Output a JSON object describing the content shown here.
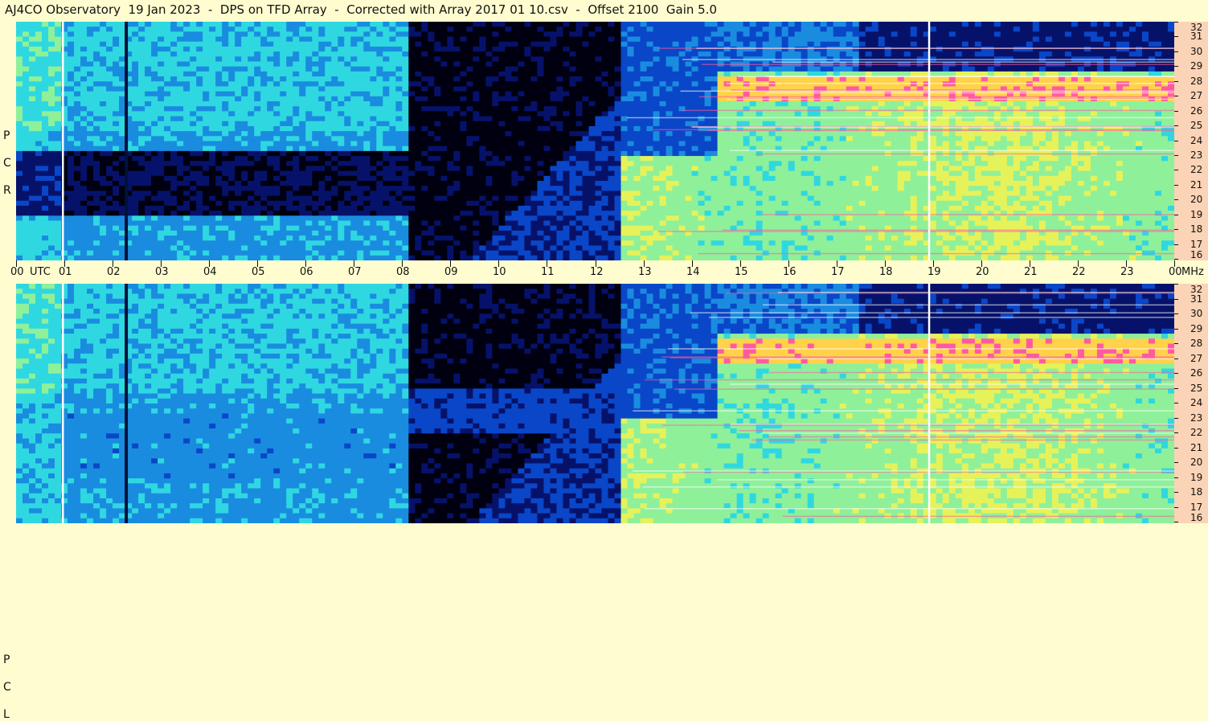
{
  "header": {
    "title": "AJ4CO Observatory  19 Jan 2023  -  DPS on TFD Array  -  Corrected with Array 2017 01 10.csv  -  Offset 2100  Gain 5.0"
  },
  "panels": {
    "top": {
      "polarization_letters": [
        "P",
        "C",
        "R"
      ]
    },
    "bottom": {
      "polarization_letters": [
        "P",
        "C",
        "L"
      ]
    }
  },
  "axes": {
    "time_tick_labels": [
      "00",
      "01",
      "02",
      "03",
      "04",
      "05",
      "06",
      "07",
      "08",
      "09",
      "10",
      "11",
      "12",
      "13",
      "14",
      "15",
      "16",
      "17",
      "18",
      "19",
      "20",
      "21",
      "22",
      "23",
      "00"
    ],
    "time_unit": "UTC",
    "freq_unit": "MHz",
    "freq_tick_labels": [
      "32",
      "31",
      "30",
      "29",
      "28",
      "27",
      "26",
      "25",
      "24",
      "23",
      "22",
      "21",
      "20",
      "19",
      "18",
      "17",
      "16"
    ]
  },
  "chart_data": {
    "type": "heatmap",
    "title": "AJ4CO Observatory  19 Jan 2023  -  DPS on TFD Array  -  Corrected with Array 2017 01 10.csv  -  Offset 2100  Gain 5.0",
    "x": {
      "label": "UTC",
      "range_hours": [
        0,
        24
      ],
      "tick_labels": [
        "00",
        "01",
        "02",
        "03",
        "04",
        "05",
        "06",
        "07",
        "08",
        "09",
        "10",
        "11",
        "12",
        "13",
        "14",
        "15",
        "16",
        "17",
        "18",
        "19",
        "20",
        "21",
        "22",
        "23",
        "00"
      ]
    },
    "y": {
      "label": "MHz",
      "range": [
        16,
        32
      ],
      "ticks": [
        32,
        31,
        30,
        29,
        28,
        27,
        26,
        25,
        24,
        23,
        22,
        21,
        20,
        19,
        18,
        17,
        16
      ]
    },
    "panels": [
      {
        "polarization": "RCP",
        "letters": [
          "P",
          "C",
          "R"
        ]
      },
      {
        "polarization": "LCP",
        "letters": [
          "P",
          "C",
          "L"
        ]
      }
    ],
    "colormap": [
      "#000010",
      "#06126a",
      "#0a46c8",
      "#1a8ce0",
      "#2fd8e0",
      "#8ff09a",
      "#e6f25a",
      "#ffd24a",
      "#ff5aa0",
      "#ffffff"
    ],
    "features": {
      "daytime_noise_hours": [
        12.6,
        24
      ],
      "night_quiet_hours": [
        8.2,
        12.6
      ],
      "interference_line_hours": [
        0.95,
        2.25,
        18.9
      ]
    }
  }
}
